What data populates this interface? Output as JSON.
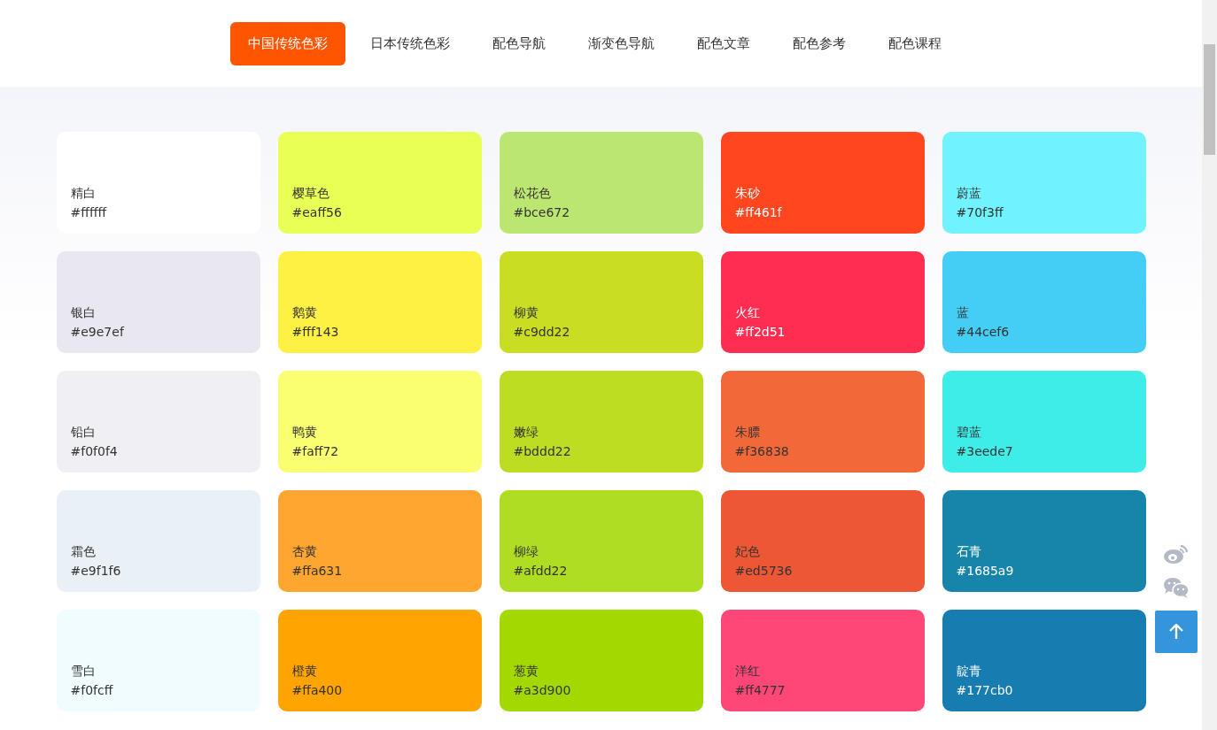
{
  "nav": {
    "tabs": [
      {
        "label": "中国传统色彩",
        "selected": true
      },
      {
        "label": "日本传统色彩",
        "selected": false
      },
      {
        "label": "配色导航",
        "selected": false
      },
      {
        "label": "渐变色导航",
        "selected": false
      },
      {
        "label": "配色文章",
        "selected": false
      },
      {
        "label": "配色参考",
        "selected": false
      },
      {
        "label": "配色课程",
        "selected": false
      }
    ]
  },
  "colors": [
    {
      "name": "精白",
      "hex": "#ffffff",
      "color": "#ffffff",
      "kind": "dark"
    },
    {
      "name": "樱草色",
      "hex": "#eaff56",
      "color": "#eaff56",
      "kind": "dark"
    },
    {
      "name": "松花色",
      "hex": "#bce672",
      "color": "#bce672",
      "kind": "dark"
    },
    {
      "name": "朱砂",
      "hex": "#ff461f",
      "color": "#ff461f",
      "kind": "light"
    },
    {
      "name": "蔚蓝",
      "hex": "#70f3ff",
      "color": "#70f3ff",
      "kind": "dark"
    },
    {
      "name": "银白",
      "hex": "#e9e7ef",
      "color": "#e9e7ef",
      "kind": "dark"
    },
    {
      "name": "鹅黄",
      "hex": "#fff143",
      "color": "#fff143",
      "kind": "dark"
    },
    {
      "name": "柳黄",
      "hex": "#c9dd22",
      "color": "#c9dd22",
      "kind": "dark"
    },
    {
      "name": "火红",
      "hex": "#ff2d51",
      "color": "#ff2d51",
      "kind": "light"
    },
    {
      "name": "蓝",
      "hex": "#44cef6",
      "color": "#44cef6",
      "kind": "dark"
    },
    {
      "name": "铅白",
      "hex": "#f0f0f4",
      "color": "#f0f0f4",
      "kind": "dark"
    },
    {
      "name": "鸭黄",
      "hex": "#faff72",
      "color": "#faff72",
      "kind": "dark"
    },
    {
      "name": "嫩绿",
      "hex": "#bddd22",
      "color": "#bddd22",
      "kind": "dark"
    },
    {
      "name": "朱膘",
      "hex": "#f36838",
      "color": "#f36838",
      "kind": "dark"
    },
    {
      "name": "碧蓝",
      "hex": "#3eede7",
      "color": "#3eede7",
      "kind": "dark"
    },
    {
      "name": "霜色",
      "hex": "#e9f1f6",
      "color": "#e9f1f6",
      "kind": "dark"
    },
    {
      "name": "杏黄",
      "hex": "#ffa631",
      "color": "#ffa631",
      "kind": "dark"
    },
    {
      "name": "柳绿",
      "hex": "#afdd22",
      "color": "#afdd22",
      "kind": "dark"
    },
    {
      "name": "妃色",
      "hex": "#ed5736",
      "color": "#ed5736",
      "kind": "dark"
    },
    {
      "name": "石青",
      "hex": "#1685a9",
      "color": "#1685a9",
      "kind": "light"
    },
    {
      "name": "雪白",
      "hex": "#f0fcff",
      "color": "#f0fcff",
      "kind": "dark"
    },
    {
      "name": "橙黄",
      "hex": "#ffa400",
      "color": "#ffa400",
      "kind": "dark"
    },
    {
      "name": "葱黄",
      "hex": "#a3d900",
      "color": "#a3d900",
      "kind": "dark"
    },
    {
      "name": "洋红",
      "hex": "#ff4777",
      "color": "#ff4777",
      "kind": "dark"
    },
    {
      "name": "靛青",
      "hex": "#177cb0",
      "color": "#177cb0",
      "kind": "light"
    }
  ]
}
